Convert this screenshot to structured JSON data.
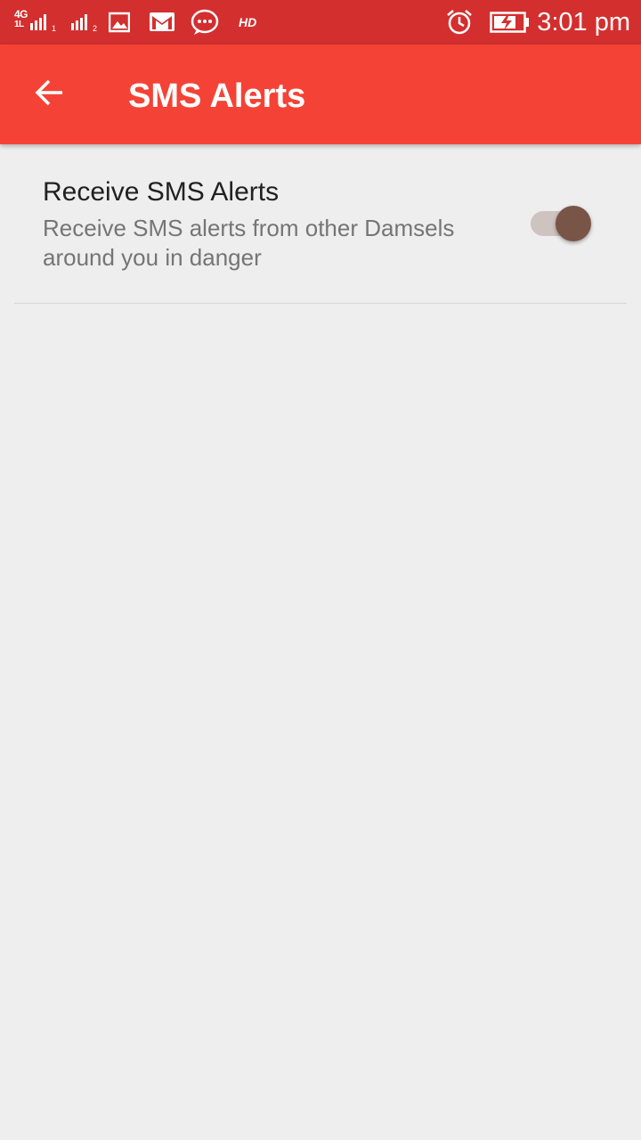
{
  "status_bar": {
    "network_label": "4G",
    "network_sub": "1L",
    "sim1_index": "1",
    "sim2_index": "2",
    "hd_label": "HD",
    "time": "3:01 pm",
    "icons": [
      "signal-sim1-icon",
      "signal-sim2-icon",
      "gallery-icon",
      "gmail-icon",
      "messaging-icon",
      "alarm-icon",
      "battery-charging-icon"
    ],
    "background": "#d32f2f"
  },
  "app_bar": {
    "title": "SMS Alerts",
    "back_icon": "arrow-back-icon",
    "background": "#f44336"
  },
  "preferences": [
    {
      "title": "Receive SMS Alerts",
      "summary": "Receive SMS alerts from other Damsels around you in danger",
      "switch_on": true,
      "switch_thumb_color": "#795548",
      "switch_track_color": "#cfc3bf"
    }
  ]
}
